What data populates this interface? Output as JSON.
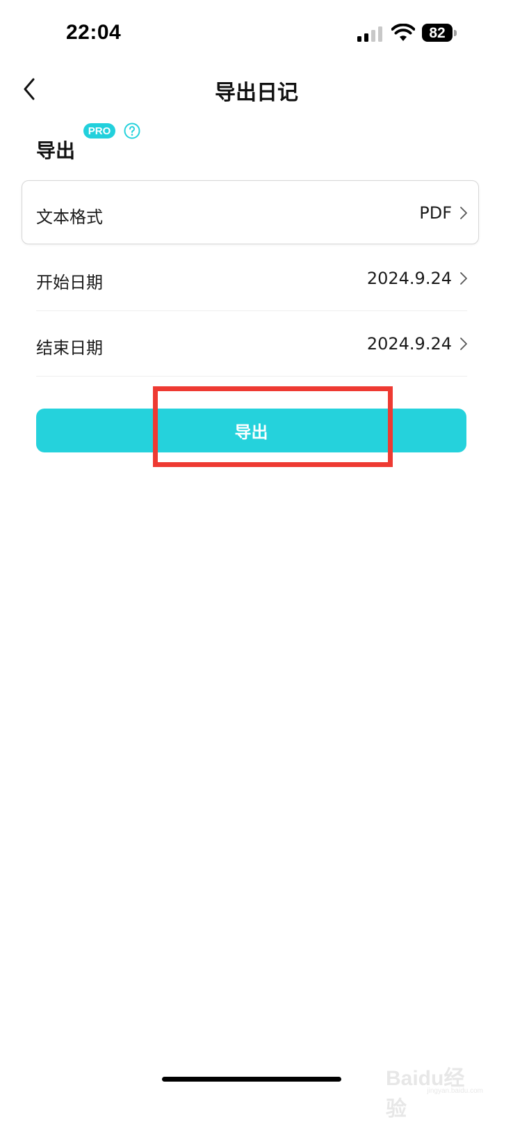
{
  "status_bar": {
    "time": "22:04",
    "battery": "82"
  },
  "nav": {
    "title": "导出日记"
  },
  "section": {
    "title": "导出",
    "badge": "PRO",
    "help_icon": "question-circle-icon"
  },
  "rows": [
    {
      "label": "文本格式",
      "value": "PDF"
    },
    {
      "label": "开始日期",
      "value": "2024.9.24"
    },
    {
      "label": "结束日期",
      "value": "2024.9.24"
    }
  ],
  "export_button": {
    "label": "导出"
  },
  "watermark": {
    "text": "Baidu经验",
    "sub": "jingyan.baidu.com"
  },
  "colors": {
    "accent": "#25d2dc",
    "highlight": "#ee3a32"
  }
}
